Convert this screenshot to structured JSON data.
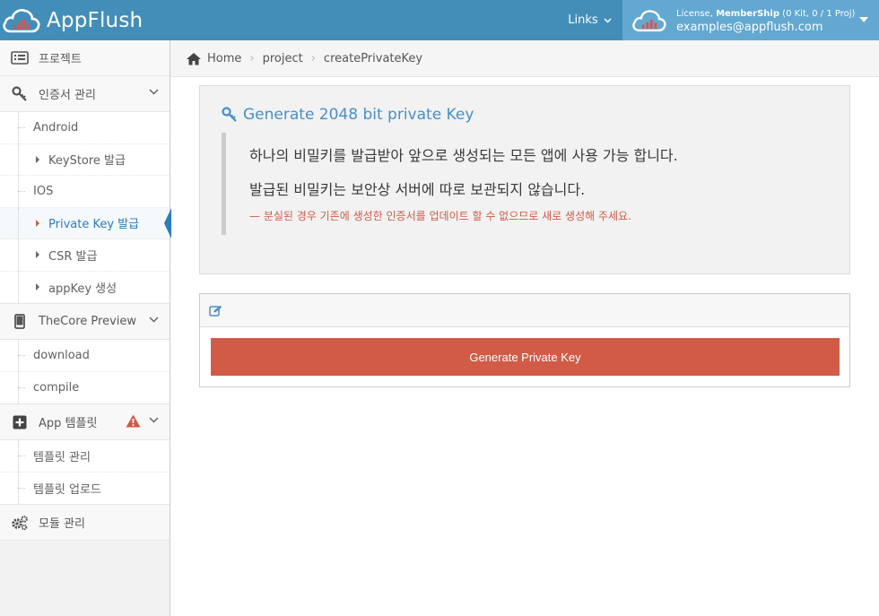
{
  "app": {
    "name": "AppFlush"
  },
  "topbar": {
    "links_label": "Links",
    "license_prefix": "License, ",
    "license_plan": "MemberShip",
    "license_suffix": " (0 Kit, 0 / 1 Proj)",
    "user_email": "examples@appflush.com"
  },
  "sidebar": {
    "projects": "프로젝트",
    "certs": "인증서 관리",
    "android": "Android",
    "keystore": "KeyStore 발급",
    "ios": "IOS",
    "private_key": "Private Key 발급",
    "csr": "CSR 발급",
    "appkey": "appKey 생성",
    "thecore": "TheCore Preview",
    "download": "download",
    "compile": "compile",
    "app_template": "App 템플릿",
    "template_manage": "템플릿 관리",
    "template_upload": "템플릿 업로드",
    "module_manage": "모듈 관리"
  },
  "breadcrumb": {
    "home": "Home",
    "project": "project",
    "current": "createPrivateKey"
  },
  "panel": {
    "title": "Generate 2048 bit private Key",
    "line1": "하나의 비밀키를 발급받아 앞으로 생성되는 모든 앱에 사용 가능 합니다.",
    "line2": "발급된 비밀키는 보안상 서버에 따로 보관되지 않습니다.",
    "warning": "— 분실된 경우 기존에 생성한 인증서를 업데이트 할 수 없으므로 새로 생성해 주세요."
  },
  "form": {
    "button": "Generate Private Key"
  },
  "colors": {
    "topbar": "#438eb9",
    "user_box": "#62a8d1",
    "accent": "#478fca",
    "danger": "#d15b47"
  }
}
